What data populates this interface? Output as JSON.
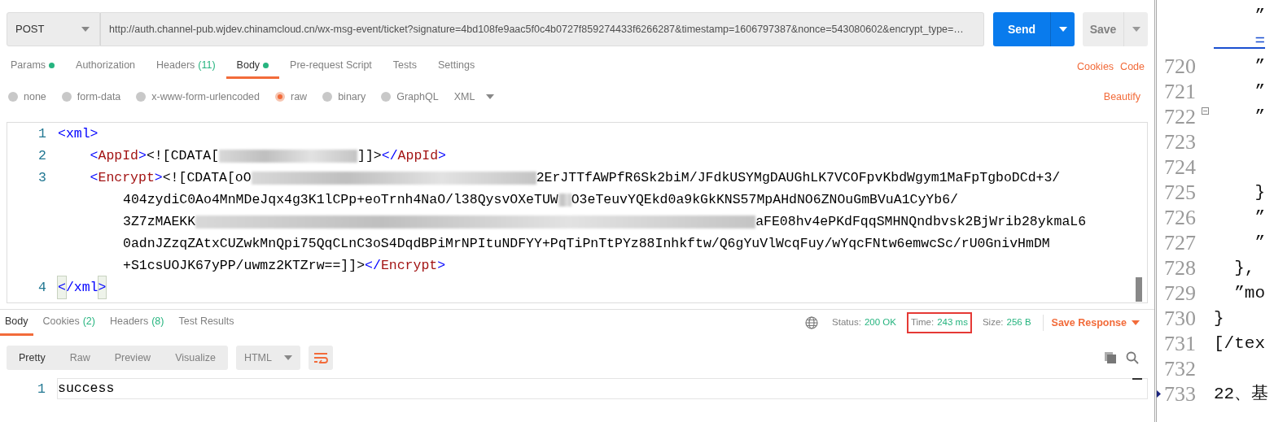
{
  "request": {
    "method": "POST",
    "url": "http://auth.channel-pub.wjdev.chinamcloud.cn/wx-msg-event/ticket?signature=4bd108fe9aac5f0c4b0727f859274433f6266287&timestamp=1606797387&nonce=543080602&encrypt_type=…",
    "send": "Send",
    "save": "Save"
  },
  "request_tabs": [
    {
      "label": "Params",
      "dot": true,
      "selected": false
    },
    {
      "label": "Authorization",
      "dot": false,
      "selected": false
    },
    {
      "label": "Headers",
      "count": "(11)",
      "dot": false,
      "selected": false
    },
    {
      "label": "Body",
      "dot": true,
      "selected": true
    },
    {
      "label": "Pre-request Script",
      "dot": false,
      "selected": false
    },
    {
      "label": "Tests",
      "dot": false,
      "selected": false
    },
    {
      "label": "Settings",
      "dot": false,
      "selected": false
    }
  ],
  "request_links": [
    "Cookies",
    "Code"
  ],
  "body_types": [
    {
      "label": "none",
      "selected": false
    },
    {
      "label": "form-data",
      "selected": false
    },
    {
      "label": "x-www-form-urlencoded",
      "selected": false
    },
    {
      "label": "raw",
      "selected": true
    },
    {
      "label": "binary",
      "selected": false
    },
    {
      "label": "GraphQL",
      "selected": false
    }
  ],
  "body_format": "XML",
  "beautify": "Beautify",
  "code_lines": [
    {
      "number": "1",
      "rows": [
        {
          "segments": [
            {
              "kind": "punct",
              "text": "<xml>"
            }
          ]
        }
      ]
    },
    {
      "number": "2",
      "rows": [
        {
          "segments": [
            {
              "kind": "indent"
            },
            {
              "kind": "punct",
              "text": "<"
            },
            {
              "kind": "tag",
              "text": "AppId"
            },
            {
              "kind": "punct",
              "text": ">"
            },
            {
              "kind": "text",
              "text": "<![CDATA["
            },
            {
              "kind": "redacted-medium"
            },
            {
              "kind": "text",
              "text": "]]>"
            },
            {
              "kind": "punct",
              "text": "</"
            },
            {
              "kind": "tag",
              "text": "AppId"
            },
            {
              "kind": "punct",
              "text": ">"
            }
          ]
        }
      ]
    },
    {
      "number": "3",
      "rows": [
        {
          "segments": [
            {
              "kind": "indent"
            },
            {
              "kind": "punct",
              "text": "<"
            },
            {
              "kind": "tag",
              "text": "Encrypt"
            },
            {
              "kind": "punct",
              "text": ">"
            },
            {
              "kind": "text",
              "text": "<![CDATA[oO"
            },
            {
              "kind": "redacted-long"
            },
            {
              "kind": "text",
              "text": "2ErJTTfAWPfR6Sk2biM/JFdkUSYMgDAUGhLK7VCOFpvKbdWgym1MaFpTgboDCd+3/"
            }
          ]
        },
        {
          "segments": [
            {
              "kind": "text",
              "text": "404zydiC0Ao4MnMDeJqx4g3K1lCPp+eoTrnh4NaO/l38QysvOXeTUW"
            },
            {
              "kind": "redacted-tiny"
            },
            {
              "kind": "text",
              "text": "O3eTeuvYQEkd0a9kGkKNS57MpAHdNO6ZNOuGmBVuA1CyYb6/"
            }
          ]
        },
        {
          "segments": [
            {
              "kind": "text",
              "text": "3Z7zMAEKK"
            },
            {
              "kind": "redacted-huge"
            },
            {
              "kind": "text",
              "text": "aFE08hv4ePKdFqqSMHNQndbvsk2BjWrib28ykmaL6"
            }
          ]
        },
        {
          "segments": [
            {
              "kind": "text",
              "text": "0adnJZzqZAtxCUZwkMnQpi75QqCLnC3oS4DqdBPiMrNPItuNDFYY+PqTiPnTtPYz88Inhkftw/Q6gYuVlWcqFuy/wYqcFNtw6emwcSc/rU0GnivHmDM"
            }
          ]
        },
        {
          "segments": [
            {
              "kind": "text",
              "text": "+S1csUOJK67yPP/uwmz2KTZrw==]]>"
            },
            {
              "kind": "punct",
              "text": "</"
            },
            {
              "kind": "tag",
              "text": "Encrypt"
            },
            {
              "kind": "punct",
              "text": ">"
            }
          ]
        }
      ]
    },
    {
      "number": "4",
      "rows": [
        {
          "segments": [
            {
              "kind": "match",
              "text": "<"
            },
            {
              "kind": "punct",
              "text": "/xml"
            },
            {
              "kind": "match",
              "text": ">"
            }
          ]
        }
      ]
    }
  ],
  "response_tabs": [
    {
      "label": "Body",
      "selected": true
    },
    {
      "label": "Cookies",
      "count": "(2)",
      "selected": false
    },
    {
      "label": "Headers",
      "count": "(8)",
      "selected": false
    },
    {
      "label": "Test Results",
      "selected": false
    }
  ],
  "status": [
    {
      "label": "Status:",
      "value": "200 OK",
      "highlighted": false
    },
    {
      "label": "Time:",
      "value": "243 ms",
      "highlighted": true
    },
    {
      "label": "Size:",
      "value": "256 B",
      "highlighted": false
    }
  ],
  "save_response": "Save Response",
  "view_modes": [
    {
      "label": "Pretty",
      "selected": true
    },
    {
      "label": "Raw",
      "selected": false
    },
    {
      "label": "Preview",
      "selected": false
    },
    {
      "label": "Visualize",
      "selected": false
    }
  ],
  "response_format": "HTML",
  "response_lines": [
    {
      "number": "1",
      "text": "success"
    }
  ],
  "side_editor": [
    {
      "text": "    ”",
      "fold": false,
      "marker": false
    },
    {
      "text": "    =",
      "link": true,
      "fold": false,
      "marker": false
    },
    {
      "number": "720",
      "text": "    ”",
      "fold": false,
      "marker": false
    },
    {
      "number": "721",
      "text": "    ”",
      "fold": false,
      "marker": false
    },
    {
      "number": "722",
      "text": "    ”",
      "fold": true,
      "marker": false
    },
    {
      "number": "723",
      "fold": false,
      "marker": false
    },
    {
      "number": "724",
      "fold": false,
      "marker": false
    },
    {
      "number": "725",
      "text": "    }",
      "fold": false,
      "marker": false
    },
    {
      "number": "726",
      "text": "    ”",
      "fold": false,
      "marker": false
    },
    {
      "number": "727",
      "text": "    ”",
      "fold": false,
      "marker": false
    },
    {
      "number": "728",
      "text": "  },",
      "fold": false,
      "marker": false
    },
    {
      "number": "729",
      "text": "  ”mo",
      "fold": false,
      "marker": false
    },
    {
      "number": "730",
      "text": "}",
      "fold": false,
      "marker": false
    },
    {
      "number": "731",
      "text": "[/tex",
      "fold": false,
      "marker": false
    },
    {
      "number": "732",
      "fold": false,
      "marker": false
    },
    {
      "number": "733",
      "text": "22、基",
      "fold": false,
      "marker": true
    }
  ]
}
